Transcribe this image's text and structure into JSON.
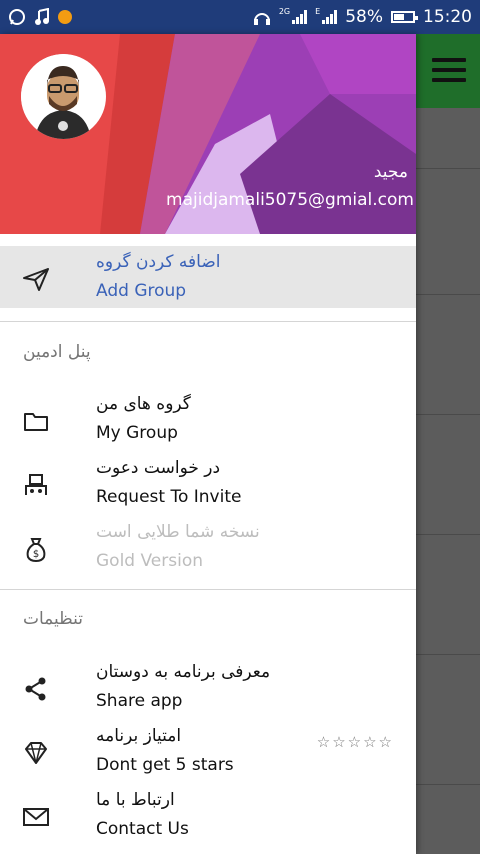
{
  "status_bar": {
    "network_top": "2G",
    "network_second": "E",
    "battery": "58%",
    "battery_level": 0.58,
    "time": "15:20"
  },
  "drawer": {
    "header": {
      "name": "مجید",
      "email": "majidjamali5075@gmial.com"
    },
    "top_item": {
      "label_fa": "اضافه کردن گروه",
      "label_en": "Add Group",
      "icon": "paper-plane-icon"
    },
    "admin_section": {
      "title": "پنل ادمین",
      "items": [
        {
          "label_fa": "گروه های من",
          "label_en": "My Group",
          "icon": "folder-icon"
        },
        {
          "label_fa": "در خواست دعوت",
          "label_en": "Request To Invite",
          "icon": "invite-icon"
        },
        {
          "label_fa": "نسخه شما طلایی است",
          "label_en": "Gold Version",
          "icon": "money-bag-icon"
        }
      ]
    },
    "settings_section": {
      "title": "تنظیمات",
      "items": [
        {
          "label_fa": "معرفی برنامه به دوستان",
          "label_en": "Share app",
          "icon": "share-icon"
        },
        {
          "label_fa": "امتیاز برنامه",
          "label_en": "Dont get 5 stars",
          "icon": "diamond-icon",
          "stars": "☆☆☆☆☆"
        },
        {
          "label_fa": "ارتباط با ما",
          "label_en": "Contact Us",
          "icon": "mail-icon"
        }
      ]
    }
  },
  "colors": {
    "status_bar": "#1f3c7a",
    "header": "#a33fb8",
    "active_text": "#3a62b8",
    "app_toolbar": "#1f6e2a"
  }
}
